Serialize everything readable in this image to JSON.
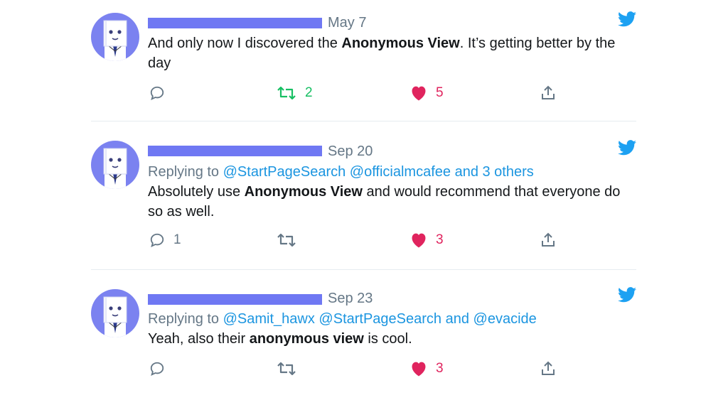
{
  "tweets": [
    {
      "date": "May 7",
      "reply_prefix": "",
      "reply_mentions": "",
      "text_before": "And only now I discovered the ",
      "text_bold": "Anonymous View",
      "text_after": ". It’s getting better by the day",
      "reply_count": "",
      "retweet_count": "2",
      "like_count": "5",
      "retweeted": true
    },
    {
      "date": "Sep 20",
      "reply_prefix": "Replying to ",
      "reply_mentions": "@StartPageSearch @officialmcafee and 3 others",
      "text_before": "Absolutely use ",
      "text_bold": "Anonymous View",
      "text_after": " and would recommend that everyone do so as well.",
      "reply_count": "1",
      "retweet_count": "",
      "like_count": "3",
      "retweeted": false
    },
    {
      "date": "Sep 23",
      "reply_prefix": "Replying to ",
      "reply_mentions": "@Samit_hawx @StartPageSearch and @evacide",
      "text_before": "Yeah, also their ",
      "text_bold": "anonymous view",
      "text_after": " is cool.",
      "reply_count": "",
      "retweet_count": "",
      "like_count": "3",
      "retweeted": false
    }
  ],
  "icons": [
    "avatar",
    "twitter-bird-icon",
    "reply-icon",
    "retweet-icon",
    "heart-icon",
    "share-icon"
  ],
  "colors": {
    "name_bar": "#6f78f3",
    "avatar_bg": "#7b82f0",
    "link": "#1b95e0",
    "twitter_blue": "#1da1f2",
    "retweet_green": "#17bf63",
    "like_red": "#e0245e",
    "muted": "#657786"
  }
}
